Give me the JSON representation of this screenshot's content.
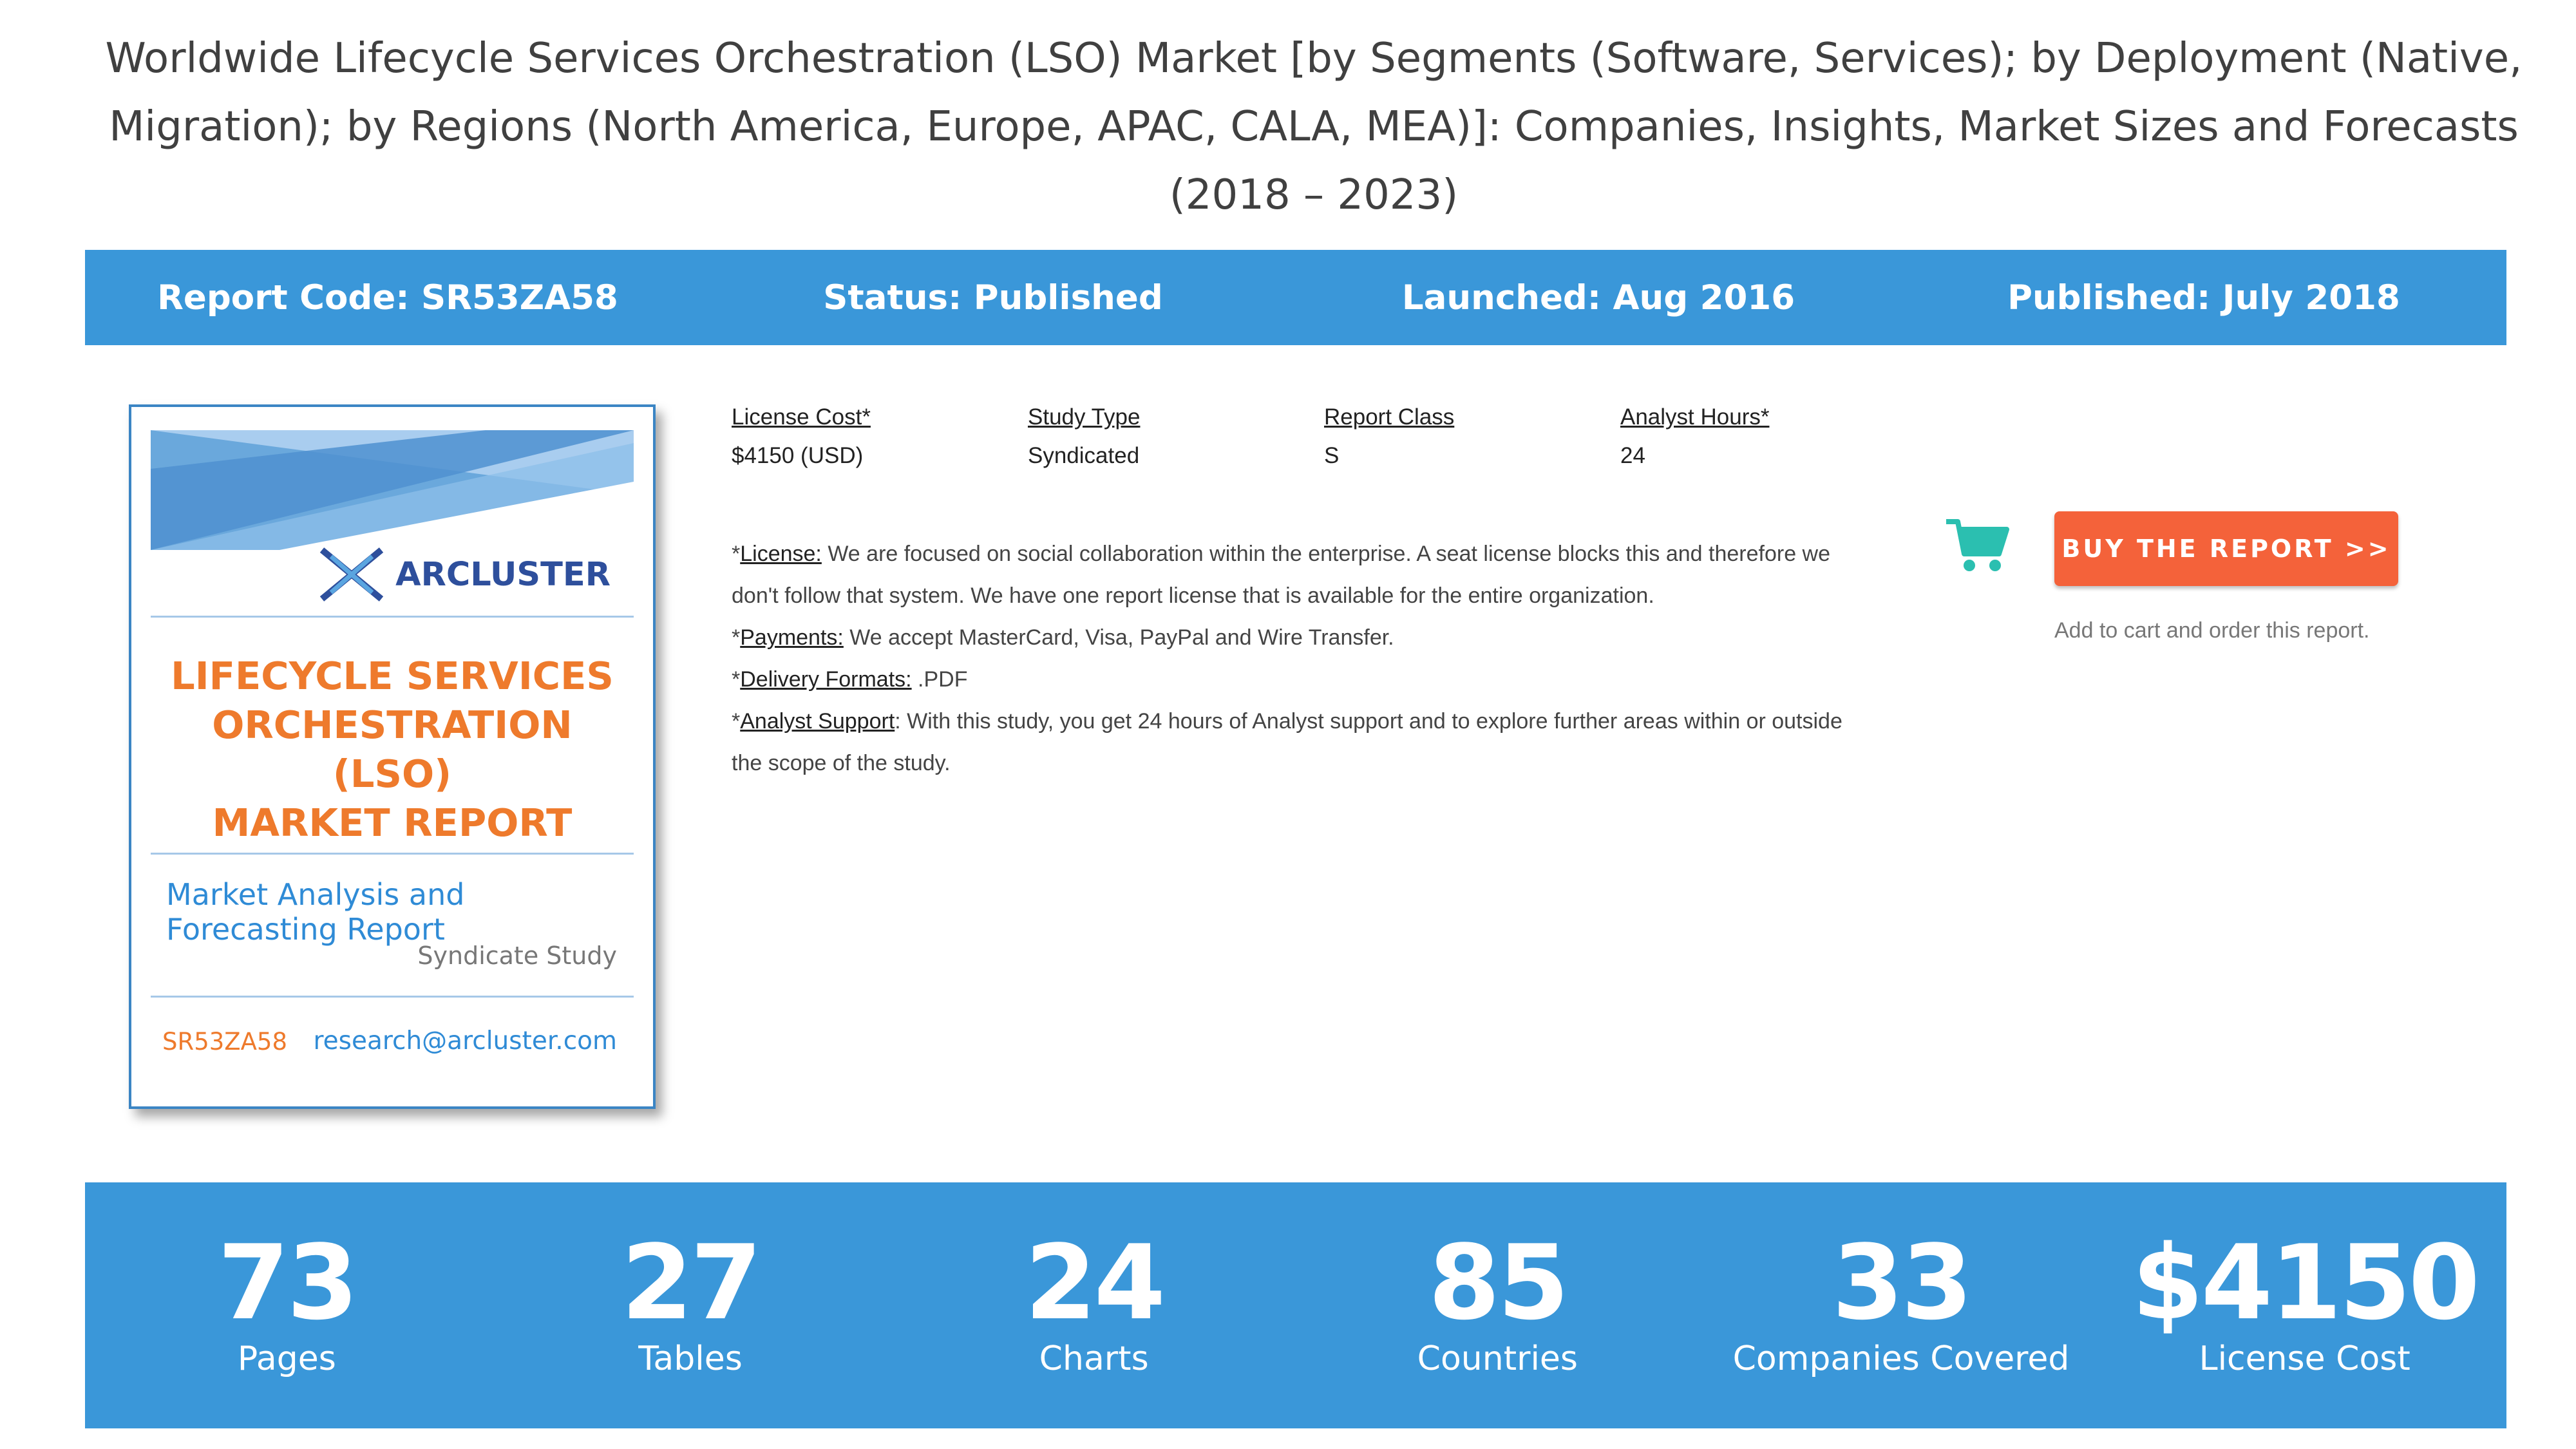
{
  "title": "Worldwide Lifecycle Services Orchestration (LSO) Market [by Segments (Software, Services); by Deployment (Native, Migration); by Regions (North America, Europe, APAC, CALA, MEA)]: Companies, Insights, Market Sizes and Forecasts (2018 – 2023)",
  "info_bar": {
    "report_code": "Report Code: SR53ZA58",
    "status": "Status: Published",
    "launched": "Launched: Aug 2016",
    "published": "Published: July 2018"
  },
  "cover": {
    "brand": "ARCLUSTER",
    "title_lines": [
      "LIFECYCLE SERVICES",
      "ORCHESTRATION (LSO)",
      "MARKET REPORT"
    ],
    "subtitle": "Market Analysis and Forecasting Report",
    "study_kind": "Syndicate Study",
    "code": "SR53ZA58",
    "email": "research@arcluster.com",
    "colors": {
      "brand_blue": "#2e4f9c",
      "title_orange": "#ee7a2c",
      "accent_blue": "#2f8bd6"
    }
  },
  "details": [
    {
      "label": "License Cost*",
      "value": "$4150 (USD)"
    },
    {
      "label": "Study Type",
      "value": "Syndicated"
    },
    {
      "label": "Report Class",
      "value": "S"
    },
    {
      "label": "Analyst Hours*",
      "value": "24"
    }
  ],
  "notes": {
    "license": {
      "prefix": "*",
      "key": "License:",
      "text": " We are focused on social collaboration within the enterprise. A seat license blocks this and therefore we don't follow that system. We have one report license that is available for the entire organization."
    },
    "payments": {
      "prefix": "*",
      "key": "Payments:",
      "text": " We accept MasterCard, Visa, PayPal and Wire Transfer."
    },
    "delivery": {
      "prefix": "*",
      "key": "Delivery Formats:",
      "text": " .PDF"
    },
    "analyst": {
      "prefix": "*",
      "key": "Analyst Support",
      "text": ": With this study, you get 24 hours of Analyst support and to explore further areas within or outside the scope of the study."
    }
  },
  "actions": {
    "cart_icon": "shopping-cart-icon",
    "buy_label": "BUY THE REPORT >>",
    "cart_hint": "Add to cart and order this report.",
    "colors": {
      "buy": "#f4623a",
      "cart": "#2bbfb0"
    }
  },
  "stats": [
    {
      "value": "73",
      "label": "Pages"
    },
    {
      "value": "27",
      "label": "Tables"
    },
    {
      "value": "24",
      "label": "Charts"
    },
    {
      "value": "85",
      "label": "Countries"
    },
    {
      "value": "33",
      "label": "Companies Covered"
    },
    {
      "value": "$4150",
      "label": "License Cost"
    }
  ],
  "theme": {
    "bar_blue": "#3a97d9"
  }
}
